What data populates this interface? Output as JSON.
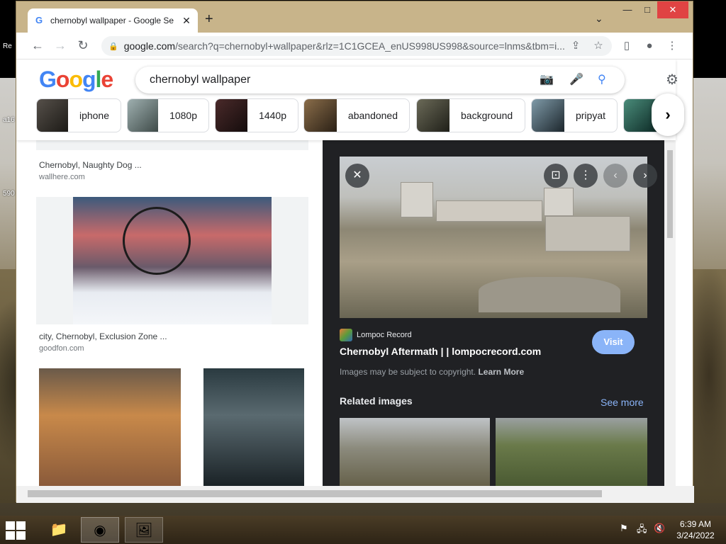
{
  "browser": {
    "tab_title": "chernobyl wallpaper - Google Se",
    "new_tab": "+",
    "url_domain": "google.com",
    "url_path": "/search?q=chernobyl+wallpaper&rlz=1C1GCEA_enUS998US998&source=lnms&tbm=i...",
    "window_controls": [
      "—",
      "□",
      "✕"
    ]
  },
  "desktop": {
    "labels": [
      "Re",
      "a16",
      "590"
    ]
  },
  "google": {
    "logo": [
      "G",
      "o",
      "o",
      "g",
      "l",
      "e"
    ],
    "logo_colors": [
      "#4285f4",
      "#ea4335",
      "#fbbc05",
      "#4285f4",
      "#34a853",
      "#ea4335"
    ],
    "query": "chernobyl wallpaper",
    "chips": [
      "iphone",
      "1080p",
      "1440p",
      "abandoned",
      "background",
      "pripyat"
    ]
  },
  "results": [
    {
      "caption": "Chernobyl, Naughty Dog ...",
      "source": "wallhere.com"
    },
    {
      "caption": "city, Chernobyl, Exclusion Zone ...",
      "source": "goodfon.com"
    }
  ],
  "panel": {
    "source_name": "Lompoc Record",
    "title": "Chernobyl Aftermath | | lompocrecord.com",
    "visit": "Visit",
    "copyright": "Images may be subject to copyright.",
    "learn_more": "Learn More",
    "related": "Related images",
    "see_more": "See more"
  },
  "taskbar": {
    "time": "6:39 AM",
    "date": "3/24/2022"
  },
  "colors": {
    "accent_blue": "#8ab4f8",
    "close_red": "#e04343",
    "panel_bg": "#202124"
  }
}
